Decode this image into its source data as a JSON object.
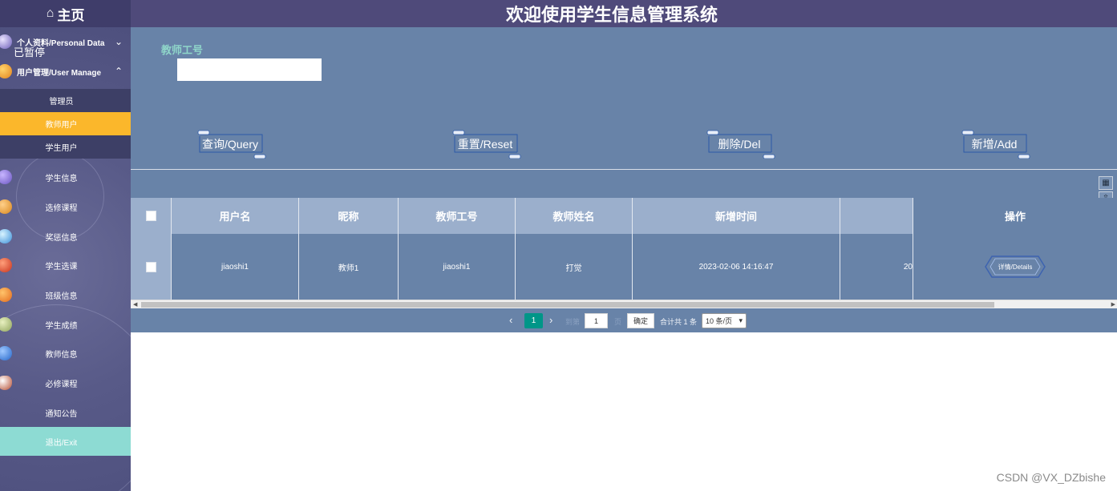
{
  "sidebar": {
    "home": "主页",
    "paused": "已暂停",
    "groups": [
      {
        "label": "个人资料/Personal Data",
        "chevron": "⌄"
      },
      {
        "label": "用户管理/User Manage",
        "chevron": "⌃"
      }
    ],
    "sub_items": [
      "管理员",
      "教师用户",
      "学生用户"
    ],
    "items": [
      "学生信息",
      "选修课程",
      "奖惩信息",
      "学生选课",
      "班级信息",
      "学生成绩",
      "教师信息",
      "必修课程",
      "通知公告"
    ],
    "exit": "退出/Exit"
  },
  "header": {
    "title": "欢迎使用学生信息管理系统"
  },
  "search": {
    "label": "教师工号",
    "value": "",
    "placeholder": ""
  },
  "actions": [
    "查询/Query",
    "重置/Reset",
    "删除/Del",
    "新增/Add"
  ],
  "table": {
    "columns": [
      "用户名",
      "昵称",
      "教师工号",
      "教师姓名",
      "新增时间",
      "",
      "操作"
    ],
    "rows": [
      {
        "username": "jiaoshi1",
        "nickname": "教师1",
        "teacher_no": "jiaoshi1",
        "teacher_name": "打觉",
        "created": "2023-02-06 14:16:47",
        "extra": "20",
        "action": "详情/Details"
      }
    ]
  },
  "pagination": {
    "current": "1",
    "goto_label": "到第",
    "goto_value": "1",
    "page_suffix": "页",
    "confirm": "确定",
    "total": "合计共 1 条",
    "page_size": "10 条/页"
  },
  "watermark": "CSDN @VX_DZbishe",
  "colors": {
    "accent": "#fbb72b",
    "active_page": "#009688",
    "exit": "#8ddbd3",
    "header": "#4f4a7a"
  }
}
